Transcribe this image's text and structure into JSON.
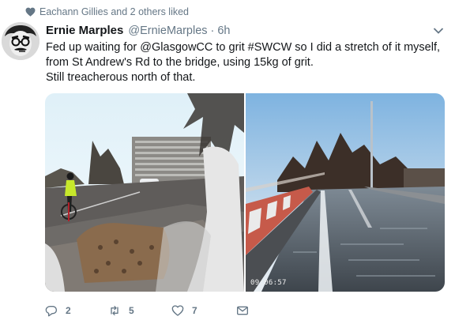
{
  "social_context": {
    "text": "Eachann Gillies and 2 others liked"
  },
  "tweet": {
    "display_name": "Ernie Marples",
    "handle": "@ErnieMarples",
    "separator": "·",
    "time": "6h",
    "text_lines": [
      "Fed up waiting for @GlasgowCC to grit #SWCW so I did a stretch of it myself,",
      "from St Andrew's Rd to the bridge, using 15kg of grit.",
      "Still treacherous north of that."
    ]
  },
  "media": {
    "right_photo_timestamp": "09:06:57"
  },
  "actions": {
    "reply_count": "2",
    "retweet_count": "5",
    "like_count": "7"
  },
  "icons": {
    "social_context": "heart-icon",
    "reply": "reply-icon",
    "retweet": "retweet-icon",
    "like": "heart-icon",
    "dm": "envelope-icon",
    "caret": "chevron-down-icon"
  },
  "colors": {
    "secondary_text": "#657786",
    "primary_text": "#14171a",
    "background": "#ffffff"
  }
}
